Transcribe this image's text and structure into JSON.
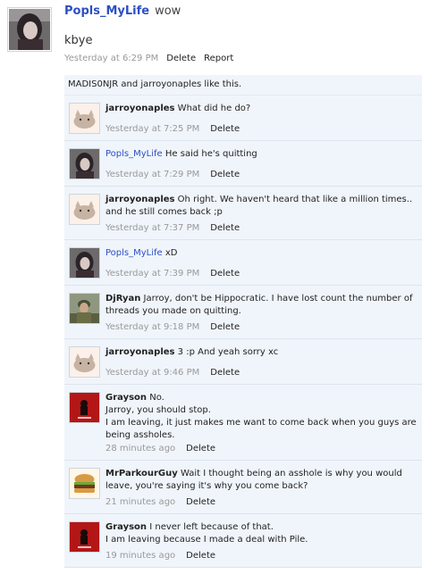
{
  "post": {
    "author": "Popls_MyLife",
    "title": "wow",
    "message": "kbye",
    "timestamp": "Yesterday at 6:29 PM",
    "delete_label": "Delete",
    "report_label": "Report",
    "likes": "MADIS0NJR and jarroyonaples like this."
  },
  "comments": [
    {
      "author": "jarroyonaples",
      "lines": [
        "What did he do?"
      ],
      "time": "Yesterday at 7:25 PM",
      "delete": "Delete"
    },
    {
      "author": "Popls_MyLife",
      "lines": [
        "He said he's quitting"
      ],
      "time": "Yesterday at 7:29 PM",
      "delete": "Delete"
    },
    {
      "author": "jarroyonaples",
      "lines": [
        "Oh right. We haven't heard that like a million times..",
        "and he still comes back ;p"
      ],
      "time": "Yesterday at 7:37 PM",
      "delete": "Delete"
    },
    {
      "author": "Popls_MyLife",
      "lines": [
        "xD"
      ],
      "time": "Yesterday at 7:39 PM",
      "delete": "Delete"
    },
    {
      "author": "DjRyan",
      "lines": [
        "Jarroy, don't be Hippocratic. I have lost count the number of",
        "threads you made on quitting."
      ],
      "time": "Yesterday at 9:18 PM",
      "delete": "Delete"
    },
    {
      "author": "jarroyonaples",
      "lines": [
        "3 :p And yeah sorry xc"
      ],
      "time": "Yesterday at 9:46 PM",
      "delete": "Delete"
    },
    {
      "author": "Grayson",
      "lines": [
        "No.",
        "Jarroy, you should stop.",
        "I am leaving, it just makes me want to come back when you guys are",
        "being assholes."
      ],
      "time": "28 minutes ago",
      "delete": "Delete"
    },
    {
      "author": "MrParkourGuy",
      "lines": [
        "Wait I thought being an asshole is why you would",
        "leave, you're saying it's why you come back?"
      ],
      "time": "21 minutes ago",
      "delete": "Delete"
    },
    {
      "author": "Grayson",
      "lines": [
        "I never left because of that.",
        "I am leaving because I made a deal with Pile."
      ],
      "time": "19 minutes ago",
      "delete": "Delete"
    }
  ]
}
